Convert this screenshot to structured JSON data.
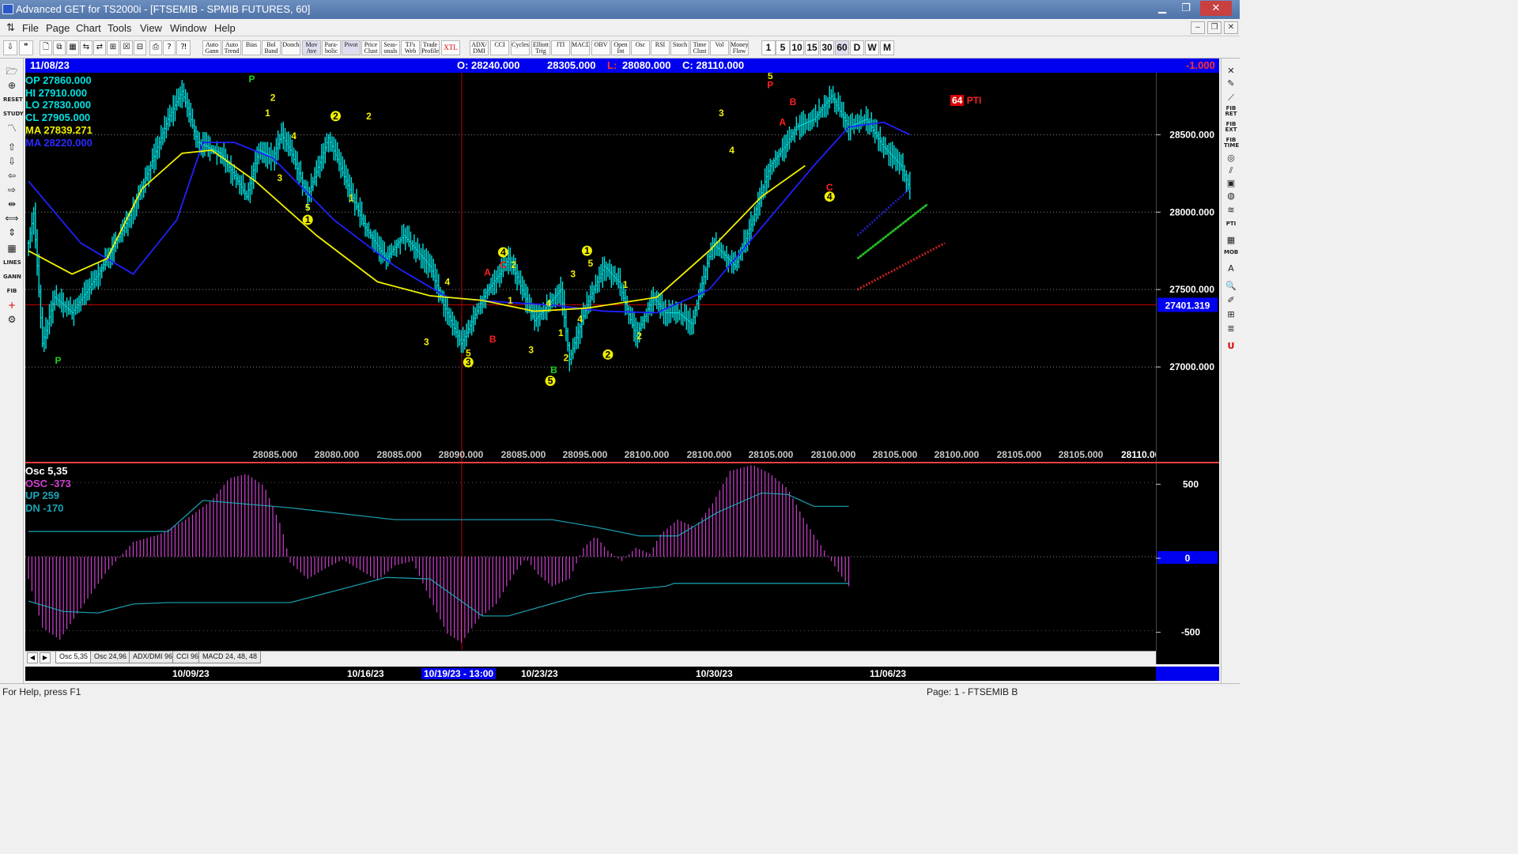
{
  "window": {
    "title": "Advanced GET for TS2000i - [FTSEMIB - SPMIB FUTURES, 60]",
    "min_glyph": "▁",
    "max_glyph": "❐",
    "close_glyph": "✕"
  },
  "menu": {
    "items": [
      "File",
      "Page",
      "Chart",
      "Tools",
      "View",
      "Window",
      "Help"
    ]
  },
  "toolbar": {
    "studies": [
      "Auto Gann",
      "Auto Trend",
      "Bias",
      "Bol Band",
      "Donch",
      "Mov Ave",
      "Para- bolic",
      "Pivot",
      "Price Clust",
      "Seas- onals",
      "TJ's Web",
      "Trade Profile",
      "XTL",
      "ADX/ DMI",
      "CCI",
      "Cycles",
      "Elliott Trig",
      "JTI",
      "MACD",
      "OBV",
      "Open Int",
      "Osc",
      "RSI",
      "Stoch",
      "Time Clust",
      "Vol",
      "Money Flow"
    ],
    "periods": [
      "1",
      "5",
      "10",
      "15",
      "30",
      "60",
      "D",
      "W",
      "M"
    ]
  },
  "infobar": {
    "date": "11/08/23",
    "open": "O: 28240.000",
    "high": "28305.000",
    "low_label": "L:",
    "low": "28080.000",
    "close": "C: 28110.000",
    "change": "-1.000"
  },
  "legend": {
    "op": "OP  27860.000",
    "hi": "HI   27910.000",
    "lo": "LO  27830.000",
    "cl": "CL  27905.000",
    "ma1": "MA  27839.271",
    "ma2": "MA  28220.000"
  },
  "colors": {
    "bars": "#00e0e0",
    "ma_fast": "#f0f000",
    "ma_slow": "#2020ff",
    "wave_count": "#f0f000",
    "abc": "#ff2020",
    "pivot": "#20d020",
    "osc": "#d040d0",
    "crosshair": "#c00000",
    "infobar": "#0000f0"
  },
  "chart_data": {
    "type": "bar",
    "symbol": "FTSEMIB - SPMIB FUTURES",
    "interval": "60",
    "ylim": [
      26500,
      28900
    ],
    "y_ticks": [
      "28500.000",
      "28000.000",
      "27500.000",
      "27000.000"
    ],
    "crosshair_value": "27401.319",
    "bottom_values": [
      "28085.000",
      "28080.000",
      "28085.000",
      "28090.000",
      "28085.000",
      "28095.000",
      "28100.000",
      "28100.000",
      "28105.000",
      "28100.000",
      "28105.000",
      "28100.000",
      "28105.000",
      "28105.000",
      "28110.000"
    ],
    "x_dates": [
      "10/09/23",
      "10/16/23",
      "10/19/23 - 13:00",
      "10/23/23",
      "10/30/23",
      "11/06/23"
    ],
    "price_path": [
      [
        0,
        27800
      ],
      [
        3,
        27990
      ],
      [
        8,
        27150
      ],
      [
        15,
        27450
      ],
      [
        25,
        27350
      ],
      [
        40,
        27600
      ],
      [
        55,
        27900
      ],
      [
        70,
        28300
      ],
      [
        80,
        28600
      ],
      [
        88,
        28780
      ],
      [
        97,
        28450
      ],
      [
        110,
        28380
      ],
      [
        120,
        28200
      ],
      [
        125,
        28100
      ],
      [
        132,
        28400
      ],
      [
        140,
        28350
      ],
      [
        145,
        28500
      ],
      [
        150,
        28400
      ],
      [
        160,
        28100
      ],
      [
        172,
        28480
      ],
      [
        182,
        28200
      ],
      [
        193,
        27900
      ],
      [
        205,
        27700
      ],
      [
        215,
        27850
      ],
      [
        230,
        27650
      ],
      [
        238,
        27400
      ],
      [
        248,
        27150
      ],
      [
        262,
        27480
      ],
      [
        270,
        27600
      ],
      [
        275,
        27700
      ],
      [
        280,
        27580
      ],
      [
        290,
        27300
      ],
      [
        305,
        27500
      ],
      [
        310,
        27050
      ],
      [
        320,
        27400
      ],
      [
        330,
        27650
      ],
      [
        338,
        27550
      ],
      [
        348,
        27200
      ],
      [
        358,
        27450
      ],
      [
        365,
        27350
      ],
      [
        372,
        27350
      ],
      [
        380,
        27280
      ],
      [
        392,
        27800
      ],
      [
        405,
        27650
      ],
      [
        415,
        27950
      ],
      [
        425,
        28300
      ],
      [
        435,
        28450
      ],
      [
        440,
        28550
      ],
      [
        450,
        28600
      ],
      [
        460,
        28750
      ],
      [
        470,
        28550
      ],
      [
        480,
        28600
      ],
      [
        490,
        28420
      ],
      [
        500,
        28300
      ],
      [
        505,
        28150
      ]
    ],
    "ma_fast": [
      [
        0,
        27750
      ],
      [
        25,
        27600
      ],
      [
        45,
        27700
      ],
      [
        65,
        28150
      ],
      [
        88,
        28380
      ],
      [
        105,
        28400
      ],
      [
        130,
        28200
      ],
      [
        165,
        27850
      ],
      [
        200,
        27550
      ],
      [
        230,
        27460
      ],
      [
        260,
        27430
      ],
      [
        290,
        27360
      ],
      [
        320,
        27380
      ],
      [
        360,
        27450
      ],
      [
        390,
        27750
      ],
      [
        420,
        28100
      ],
      [
        445,
        28300
      ]
    ],
    "ma_slow": [
      [
        0,
        28200
      ],
      [
        30,
        27800
      ],
      [
        60,
        27600
      ],
      [
        85,
        27950
      ],
      [
        100,
        28450
      ],
      [
        118,
        28450
      ],
      [
        140,
        28350
      ],
      [
        175,
        27950
      ],
      [
        210,
        27650
      ],
      [
        240,
        27450
      ],
      [
        270,
        27420
      ],
      [
        300,
        27400
      ],
      [
        330,
        27360
      ],
      [
        360,
        27350
      ],
      [
        390,
        27500
      ],
      [
        420,
        27900
      ],
      [
        450,
        28300
      ],
      [
        470,
        28550
      ],
      [
        490,
        28580
      ],
      [
        505,
        28500
      ]
    ],
    "trend_green": [
      [
        475,
        27700
      ],
      [
        515,
        28050
      ]
    ],
    "trend_red": [
      [
        475,
        27500
      ],
      [
        525,
        27800
      ]
    ],
    "trend_blue": [
      [
        475,
        27850
      ],
      [
        505,
        28150
      ]
    ],
    "x_count": 530,
    "wave_labels": [
      {
        "t": "P",
        "x": 128,
        "y": 28840,
        "c": "pivot"
      },
      {
        "t": "P",
        "x": 17,
        "y": 27020,
        "c": "pivot"
      },
      {
        "t": "2",
        "x": 140,
        "y": 28720,
        "c": "wave"
      },
      {
        "t": "1",
        "x": 137,
        "y": 28620,
        "c": "wave"
      },
      {
        "t": "4",
        "x": 152,
        "y": 28470,
        "c": "wave"
      },
      {
        "t": "3",
        "x": 144,
        "y": 28200,
        "c": "wave"
      },
      {
        "t": "5",
        "x": 160,
        "y": 28010,
        "c": "wave"
      },
      {
        "t": "1",
        "x": 160,
        "y": 27930,
        "c": "wave",
        "circle": true
      },
      {
        "t": "2",
        "x": 176,
        "y": 28600,
        "c": "wave",
        "circle": true
      },
      {
        "t": "2",
        "x": 195,
        "y": 28600,
        "c": "wave"
      },
      {
        "t": "1",
        "x": 185,
        "y": 28070,
        "c": "wave"
      },
      {
        "t": "3",
        "x": 228,
        "y": 27140,
        "c": "wave"
      },
      {
        "t": "4",
        "x": 240,
        "y": 27530,
        "c": "wave"
      },
      {
        "t": "5",
        "x": 252,
        "y": 27070,
        "c": "wave"
      },
      {
        "t": "3",
        "x": 252,
        "y": 27010,
        "c": "wave",
        "circle": true
      },
      {
        "t": "A",
        "x": 263,
        "y": 27590,
        "c": "abc"
      },
      {
        "t": "B",
        "x": 266,
        "y": 27160,
        "c": "abc"
      },
      {
        "t": "4",
        "x": 272,
        "y": 27720,
        "c": "wave",
        "circle": true
      },
      {
        "t": "C",
        "x": 272,
        "y": 27640,
        "c": "abc"
      },
      {
        "t": "2",
        "x": 278,
        "y": 27640,
        "c": "wave"
      },
      {
        "t": "1",
        "x": 276,
        "y": 27410,
        "c": "wave"
      },
      {
        "t": "3",
        "x": 288,
        "y": 27090,
        "c": "wave"
      },
      {
        "t": "4",
        "x": 298,
        "y": 27390,
        "c": "wave"
      },
      {
        "t": "1",
        "x": 305,
        "y": 27200,
        "c": "wave"
      },
      {
        "t": "2",
        "x": 308,
        "y": 27040,
        "c": "wave"
      },
      {
        "t": "B",
        "x": 301,
        "y": 26960,
        "c": "pivot"
      },
      {
        "t": "5",
        "x": 299,
        "y": 26890,
        "c": "wave",
        "circle": true
      },
      {
        "t": "3",
        "x": 312,
        "y": 27580,
        "c": "wave"
      },
      {
        "t": "4",
        "x": 316,
        "y": 27290,
        "c": "wave"
      },
      {
        "t": "5",
        "x": 322,
        "y": 27650,
        "c": "wave"
      },
      {
        "t": "1",
        "x": 320,
        "y": 27730,
        "c": "wave",
        "circle": true
      },
      {
        "t": "2",
        "x": 332,
        "y": 27060,
        "c": "wave",
        "circle": true
      },
      {
        "t": "1",
        "x": 342,
        "y": 27510,
        "c": "wave"
      },
      {
        "t": "2",
        "x": 350,
        "y": 27180,
        "c": "wave"
      },
      {
        "t": "3",
        "x": 397,
        "y": 28620,
        "c": "wave"
      },
      {
        "t": "4",
        "x": 403,
        "y": 28380,
        "c": "wave"
      },
      {
        "t": "5",
        "x": 425,
        "y": 28860,
        "c": "wave"
      },
      {
        "t": "P",
        "x": 425,
        "y": 28800,
        "c": "abc"
      },
      {
        "t": "B",
        "x": 438,
        "y": 28690,
        "c": "abc"
      },
      {
        "t": "A",
        "x": 432,
        "y": 28560,
        "c": "abc"
      },
      {
        "t": "C",
        "x": 459,
        "y": 28140,
        "c": "abc"
      },
      {
        "t": "4",
        "x": 459,
        "y": 28080,
        "c": "wave",
        "circle": true
      }
    ],
    "pti_box": "64",
    "pti_label": "PTI"
  },
  "osc": {
    "osc_label": "Osc 5,35",
    "value_label": "OSC -373",
    "up_label": "UP   259",
    "dn_label": "DN   -170",
    "y_ticks": [
      "500",
      "0",
      "-500"
    ],
    "ylim": [
      -630,
      630
    ],
    "bars": [
      [
        0,
        -150
      ],
      [
        8,
        -480
      ],
      [
        18,
        -560
      ],
      [
        30,
        -350
      ],
      [
        45,
        -100
      ],
      [
        60,
        100
      ],
      [
        75,
        150
      ],
      [
        90,
        250
      ],
      [
        105,
        380
      ],
      [
        115,
        530
      ],
      [
        125,
        560
      ],
      [
        135,
        480
      ],
      [
        145,
        200
      ],
      [
        150,
        -40
      ],
      [
        160,
        -150
      ],
      [
        170,
        -80
      ],
      [
        180,
        -20
      ],
      [
        190,
        -90
      ],
      [
        200,
        -160
      ],
      [
        210,
        -60
      ],
      [
        220,
        -30
      ],
      [
        230,
        -280
      ],
      [
        240,
        -520
      ],
      [
        248,
        -580
      ],
      [
        258,
        -420
      ],
      [
        268,
        -320
      ],
      [
        278,
        -120
      ],
      [
        285,
        -10
      ],
      [
        292,
        -120
      ],
      [
        300,
        -200
      ],
      [
        310,
        -150
      ],
      [
        318,
        60
      ],
      [
        325,
        140
      ],
      [
        332,
        40
      ],
      [
        340,
        -30
      ],
      [
        348,
        60
      ],
      [
        356,
        20
      ],
      [
        362,
        150
      ],
      [
        372,
        250
      ],
      [
        382,
        200
      ],
      [
        392,
        360
      ],
      [
        402,
        580
      ],
      [
        415,
        620
      ],
      [
        425,
        560
      ],
      [
        435,
        460
      ],
      [
        445,
        240
      ],
      [
        455,
        60
      ],
      [
        465,
        -120
      ],
      [
        470,
        -200
      ]
    ],
    "up_line": [
      [
        0,
        170
      ],
      [
        80,
        170
      ],
      [
        100,
        380
      ],
      [
        150,
        330
      ],
      [
        210,
        250
      ],
      [
        300,
        250
      ],
      [
        325,
        200
      ],
      [
        350,
        140
      ],
      [
        372,
        140
      ],
      [
        395,
        300
      ],
      [
        420,
        430
      ],
      [
        435,
        420
      ],
      [
        450,
        340
      ],
      [
        470,
        340
      ]
    ],
    "dn_line": [
      [
        0,
        -300
      ],
      [
        20,
        -370
      ],
      [
        40,
        -380
      ],
      [
        60,
        -320
      ],
      [
        80,
        -310
      ],
      [
        150,
        -310
      ],
      [
        205,
        -140
      ],
      [
        230,
        -150
      ],
      [
        260,
        -400
      ],
      [
        275,
        -400
      ],
      [
        320,
        -250
      ],
      [
        365,
        -200
      ],
      [
        370,
        -180
      ],
      [
        470,
        -180
      ]
    ],
    "tabs": [
      "Osc 5,35",
      "Osc 24,96",
      "ADX/DMI 96",
      "CCI 96",
      "MACD 24, 48, 48"
    ]
  },
  "status": {
    "help": "For Help, press F1",
    "page": "Page: 1 - FTSEMIB B"
  }
}
